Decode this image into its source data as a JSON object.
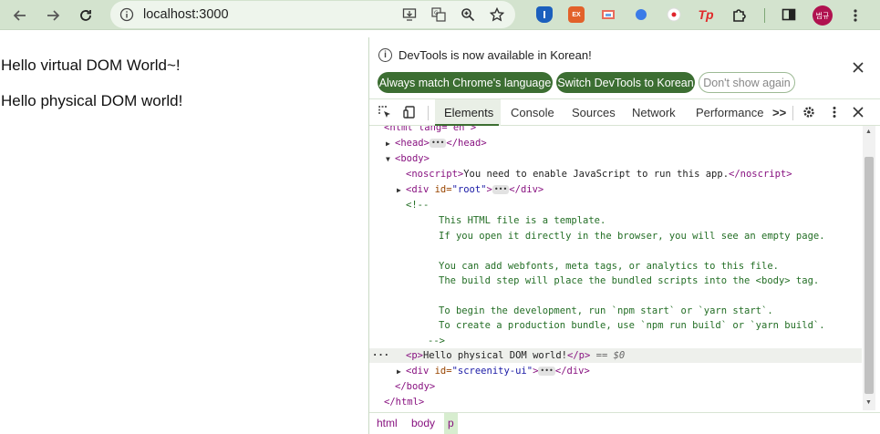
{
  "browser": {
    "url": "localhost:3000",
    "profile_initials": "범규",
    "icons": [
      "back-arrow-icon",
      "forward-arrow-icon",
      "reload-icon",
      "site-info-icon",
      "install-icon",
      "translate-icon",
      "zoom-icon",
      "bookmark-star-icon"
    ],
    "extensions": [
      "bitwarden-extension-icon",
      "ex-extension-icon",
      "cast-extension-icon",
      "blue-dot-extension-icon",
      "record-extension-icon",
      "tp-extension-icon",
      "puzzle-extension-icon",
      "sidepanel-icon"
    ],
    "ext_labels": {
      "ex": "EX",
      "tp": "Tp"
    }
  },
  "page": {
    "line1": "Hello virtual DOM World~!",
    "line2": "Hello physical DOM world!"
  },
  "devtools": {
    "info_text": "DevTools is now available in Korean!",
    "btn_match": "Always match Chrome's language",
    "btn_switch": "Switch DevTools to Korean",
    "btn_dont_show": "Don't show again",
    "tabs": [
      "Elements",
      "Console",
      "Sources",
      "Network",
      "Performance"
    ],
    "more_tabs": ">>",
    "accent": "#3c6e32",
    "code": {
      "html_open": "<html lang=\"en\">",
      "head": "<head>",
      "head_close": "</head>",
      "body_open": "<body>",
      "noscript_open": "<noscript>",
      "noscript_text": "You need to enable JavaScript to run this app.",
      "noscript_close": "</noscript>",
      "div_root_tag": "<div ",
      "div_root_attr": "id=",
      "div_root_val": "\"root\"",
      "div_close": "</div>",
      "comment_open": "<!--",
      "comment_lines": [
        "This HTML file is a template.",
        "If you open it directly in the browser, you will see an empty page.",
        "",
        "You can add webfonts, meta tags, or analytics to this file.",
        "The build step will place the bundled scripts into the <body> tag.",
        "",
        "To begin the development, run `npm start` or `yarn start`.",
        "To create a production bundle, use `npm run build` or `yarn build`."
      ],
      "comment_close": "-->",
      "p_open": "<p>",
      "p_text": "Hello physical DOM world!",
      "p_close": "</p>",
      "p_suffix": " == $0",
      "div_sc_val": "\"screenity-ui\"",
      "body_close": "</body>",
      "html_close": "</html>"
    },
    "breadcrumbs": [
      "html",
      "body",
      "p"
    ]
  }
}
